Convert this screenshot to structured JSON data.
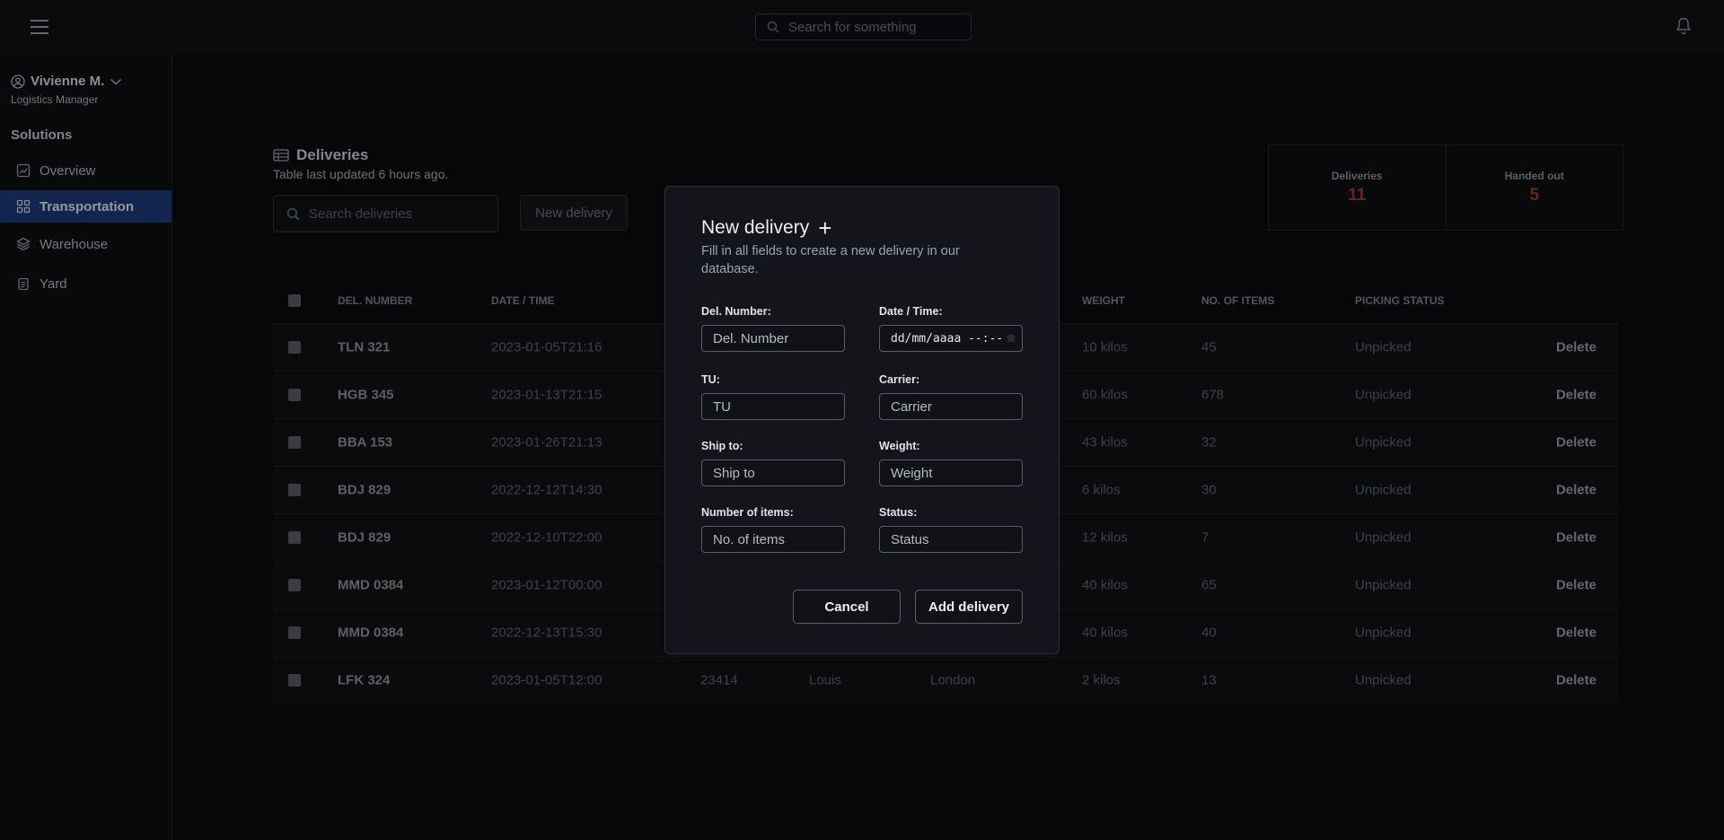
{
  "topbar": {
    "search_placeholder": "Search for something"
  },
  "sidebar": {
    "user_name": "Vivienne M.",
    "user_role": "Logistics Manager",
    "section_title": "Solutions",
    "items": [
      {
        "label": "Overview",
        "icon": "chart-icon",
        "active": false
      },
      {
        "label": "Transportation",
        "icon": "grid-icon",
        "active": true
      },
      {
        "label": "Warehouse",
        "icon": "layers-icon",
        "active": false
      },
      {
        "label": "Yard",
        "icon": "clipboard-icon",
        "active": false
      }
    ]
  },
  "main": {
    "title": "Deliveries",
    "subtitle": "Table last updated 6 hours ago.",
    "search_placeholder": "Search deliveries",
    "new_button": "New delivery",
    "stats": [
      {
        "label": "Deliveries",
        "value": "11"
      },
      {
        "label": "Handed out",
        "value": "5"
      }
    ],
    "stat_color": "#9c3b2e"
  },
  "table": {
    "headers": [
      "DEL. NUMBER",
      "DATE / TIME",
      "WEIGHT",
      "NO. OF ITEMS",
      "PICKING STATUS"
    ],
    "delete_label": "Delete",
    "rows": [
      {
        "del": "TLN 321",
        "date": "2023-01-05T21:16",
        "tu": "",
        "carrier": "",
        "ship": "",
        "weight": "10 kilos",
        "items": "45",
        "status": "Unpicked"
      },
      {
        "del": "HGB 345",
        "date": "2023-01-13T21:15",
        "tu": "",
        "carrier": "",
        "ship": "",
        "weight": "60 kilos",
        "items": "678",
        "status": "Unpicked"
      },
      {
        "del": "BBA 153",
        "date": "2023-01-26T21:13",
        "tu": "",
        "carrier": "",
        "ship": "",
        "weight": "43 kilos",
        "items": "32",
        "status": "Unpicked"
      },
      {
        "del": "BDJ 829",
        "date": "2022-12-12T14:30",
        "tu": "",
        "carrier": "",
        "ship": "",
        "weight": "6 kilos",
        "items": "30",
        "status": "Unpicked"
      },
      {
        "del": "BDJ 829",
        "date": "2022-12-10T22:00",
        "tu": "",
        "carrier": "",
        "ship": "",
        "weight": "12 kilos",
        "items": "7",
        "status": "Unpicked"
      },
      {
        "del": "MMD 0384",
        "date": "2023-01-12T00:00",
        "tu": "",
        "carrier": "",
        "ship": "",
        "weight": "40 kilos",
        "items": "65",
        "status": "Unpicked"
      },
      {
        "del": "MMD 0384",
        "date": "2022-12-13T15:30",
        "tu": "",
        "carrier": "",
        "ship": "",
        "weight": "40 kilos",
        "items": "40",
        "status": "Unpicked"
      },
      {
        "del": "LFK 324",
        "date": "2023-01-05T12:00",
        "tu": "23414",
        "carrier": "Louis",
        "ship": "London",
        "weight": "2 kilos",
        "items": "13",
        "status": "Unpicked"
      }
    ]
  },
  "modal": {
    "title": "New delivery",
    "plus": "+",
    "description": "Fill in all fields to create a new delivery in our database.",
    "fields": [
      {
        "label": "Del. Number:",
        "placeholder": "Del. Number"
      },
      {
        "label": "Date / Time:",
        "value": "dd/mm/aaaa --:--"
      },
      {
        "label": "TU:",
        "placeholder": "TU"
      },
      {
        "label": "Carrier:",
        "placeholder": "Carrier"
      },
      {
        "label": "Ship to:",
        "placeholder": "Ship to"
      },
      {
        "label": "Weight:",
        "placeholder": "Weight"
      },
      {
        "label": "Number of items:",
        "placeholder": "No. of items"
      },
      {
        "label": "Status:",
        "placeholder": "Status"
      }
    ],
    "cancel_label": "Cancel",
    "add_label": "Add delivery"
  }
}
